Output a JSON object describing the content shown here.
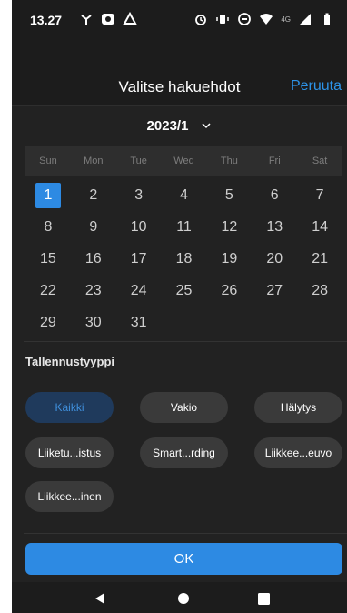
{
  "status_bar": {
    "time": "13.27",
    "network_label": "4G"
  },
  "header": {
    "title": "Valitse hakuehdot",
    "cancel_label": "Peruuta"
  },
  "calendar": {
    "month_label": "2023/1",
    "weekdays": [
      "Sun",
      "Mon",
      "Tue",
      "Wed",
      "Thu",
      "Fri",
      "Sat"
    ],
    "weeks": [
      [
        "1",
        "2",
        "3",
        "4",
        "5",
        "6",
        "7"
      ],
      [
        "8",
        "9",
        "10",
        "11",
        "12",
        "13",
        "14"
      ],
      [
        "15",
        "16",
        "17",
        "18",
        "19",
        "20",
        "21"
      ],
      [
        "22",
        "23",
        "24",
        "25",
        "26",
        "27",
        "28"
      ],
      [
        "29",
        "30",
        "31",
        "",
        "",
        "",
        ""
      ]
    ],
    "selected_day": "1"
  },
  "recording_type": {
    "title": "Tallennustyyppi",
    "options": [
      {
        "label": "Kaikki",
        "selected": true
      },
      {
        "label": "Vakio",
        "selected": false
      },
      {
        "label": "Hälytys",
        "selected": false
      },
      {
        "label": "Liiketu...istus",
        "selected": false
      },
      {
        "label": "Smart...rding",
        "selected": false
      },
      {
        "label": "Liikkee...euvo",
        "selected": false
      },
      {
        "label": "Liikkee...inen",
        "selected": false
      }
    ]
  },
  "ok_label": "OK",
  "colors": {
    "accent": "#2d8ae3",
    "background": "#222222",
    "chip": "#3a3a3a",
    "chip_active": "#1f3a5c"
  }
}
